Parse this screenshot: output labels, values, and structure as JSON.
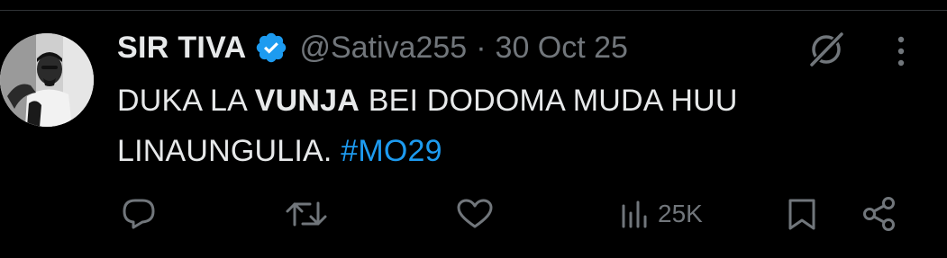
{
  "author": {
    "name": "SIR TIVA",
    "handle": "@Sativa255",
    "separator": "·",
    "date": "30 Oct 25",
    "verified": true,
    "verified_color": "#1d9bf0"
  },
  "tweet": {
    "text_part1": "DUKA LA ",
    "text_bold": "VUNJA",
    "text_part2": " BEI DODOMA MUDA HUU LINAUNGULIA. ",
    "hashtag": "#MO29"
  },
  "actions": {
    "reply_icon": "comment-icon",
    "retweet_icon": "retweet-icon",
    "like_icon": "heart-icon",
    "views_icon": "analytics-icon",
    "views_count": "25K",
    "bookmark_icon": "bookmark-icon",
    "share_icon": "share-icon"
  },
  "colors": {
    "background": "#000000",
    "text": "#e7e9ea",
    "muted": "#71767b",
    "accent": "#1d9bf0"
  }
}
